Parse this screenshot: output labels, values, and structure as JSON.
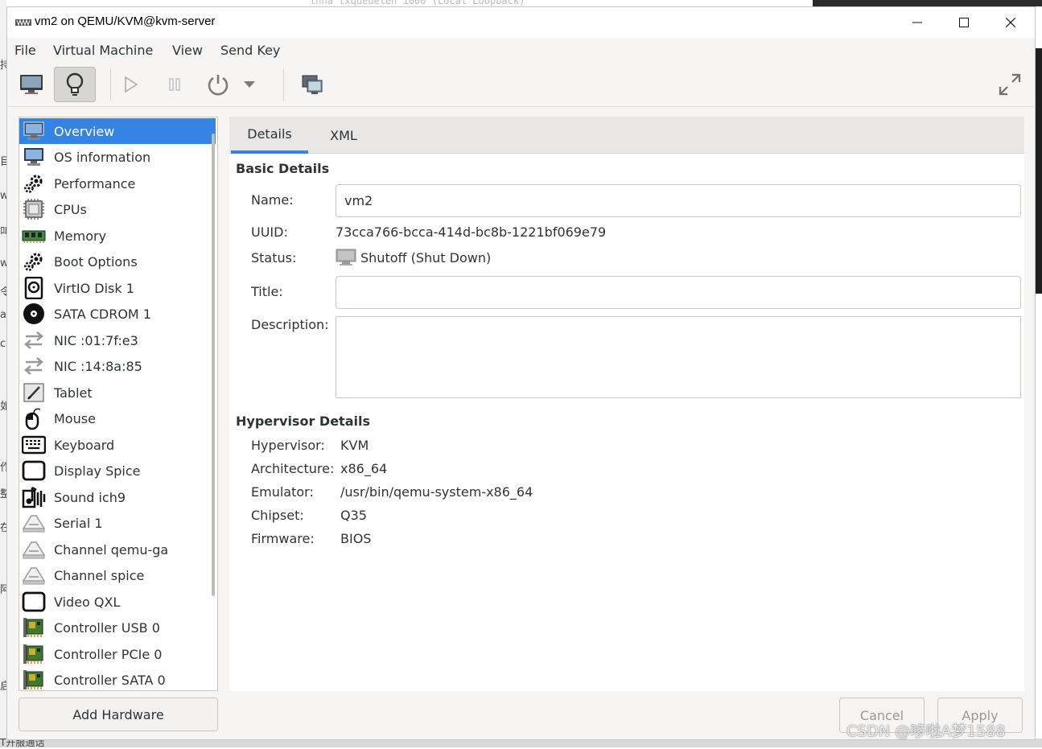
{
  "background": {
    "terminal_text": "lnna  txqueuelen 1000  (Local Loopback)",
    "left_edge_chars": [
      "持",
      "目",
      "w",
      "叫",
      "w",
      "令",
      "al",
      "c",
      "如",
      "作",
      "整",
      "在",
      "阿",
      "启"
    ],
    "bottom_text": "T开服通话"
  },
  "window": {
    "title": "vm2 on QEMU/KVM@kvm-server",
    "minimize": "—",
    "maximize": "☐",
    "close": "✕"
  },
  "menu": [
    "File",
    "Virtual Machine",
    "View",
    "Send Key"
  ],
  "toolbar": {
    "console_icon": "monitor-icon",
    "details_icon": "lightbulb-icon",
    "run_icon": "play-icon",
    "pause_icon": "pause-icon",
    "power_icon": "power-icon",
    "power_menu_icon": "dropdown-arrow-icon",
    "snapshot_icon": "snapshot-icon",
    "fullscreen_icon": "fullscreen-icon"
  },
  "sidebar": {
    "items": [
      {
        "label": "Overview",
        "icon": "monitor-icon",
        "selected": true
      },
      {
        "label": "OS information",
        "icon": "monitor-icon"
      },
      {
        "label": "Performance",
        "icon": "gears-icon"
      },
      {
        "label": "CPUs",
        "icon": "cpu-chip-icon"
      },
      {
        "label": "Memory",
        "icon": "memory-module-icon"
      },
      {
        "label": "Boot Options",
        "icon": "gears-icon"
      },
      {
        "label": "VirtIO Disk 1",
        "icon": "disk-icon"
      },
      {
        "label": "SATA CDROM 1",
        "icon": "cdrom-icon"
      },
      {
        "label": "NIC :01:7f:e3",
        "icon": "network-arrows-icon"
      },
      {
        "label": "NIC :14:8a:85",
        "icon": "network-arrows-icon"
      },
      {
        "label": "Tablet",
        "icon": "tablet-icon"
      },
      {
        "label": "Mouse",
        "icon": "mouse-icon"
      },
      {
        "label": "Keyboard",
        "icon": "keyboard-icon"
      },
      {
        "label": "Display Spice",
        "icon": "display-icon"
      },
      {
        "label": "Sound ich9",
        "icon": "sound-icon"
      },
      {
        "label": "Serial 1",
        "icon": "serial-port-icon"
      },
      {
        "label": "Channel qemu-ga",
        "icon": "serial-port-icon"
      },
      {
        "label": "Channel spice",
        "icon": "serial-port-icon"
      },
      {
        "label": "Video QXL",
        "icon": "display-icon"
      },
      {
        "label": "Controller USB 0",
        "icon": "controller-card-icon"
      },
      {
        "label": "Controller PCIe 0",
        "icon": "controller-card-icon"
      },
      {
        "label": "Controller SATA 0",
        "icon": "controller-card-icon"
      }
    ],
    "add_hardware": "Add Hardware"
  },
  "tabs": [
    "Details",
    "XML"
  ],
  "basic_details": {
    "title": "Basic Details",
    "name_label": "Name:",
    "name_value": "vm2",
    "uuid_label": "UUID:",
    "uuid_value": "73cca766-bcca-414d-bc8b-1221bf069e79",
    "status_label": "Status:",
    "status_value": "Shutoff (Shut Down)",
    "title_label": "Title:",
    "title_value": "",
    "description_label": "Description:",
    "description_value": ""
  },
  "hypervisor_details": {
    "title": "Hypervisor Details",
    "rows": [
      {
        "label": "Hypervisor:",
        "value": "KVM"
      },
      {
        "label": "Architecture:",
        "value": "x86_64"
      },
      {
        "label": "Emulator:",
        "value": "/usr/bin/qemu-system-x86_64"
      },
      {
        "label": "Chipset:",
        "value": "Q35"
      },
      {
        "label": "Firmware:",
        "value": "BIOS"
      }
    ]
  },
  "buttons": {
    "cancel": "Cancel",
    "apply": "Apply"
  },
  "watermark": "CSDN @哆啦A梦1588",
  "colors": {
    "accent": "#3584e4",
    "text": "#2e3436",
    "disabled_text": "#9a9996"
  }
}
